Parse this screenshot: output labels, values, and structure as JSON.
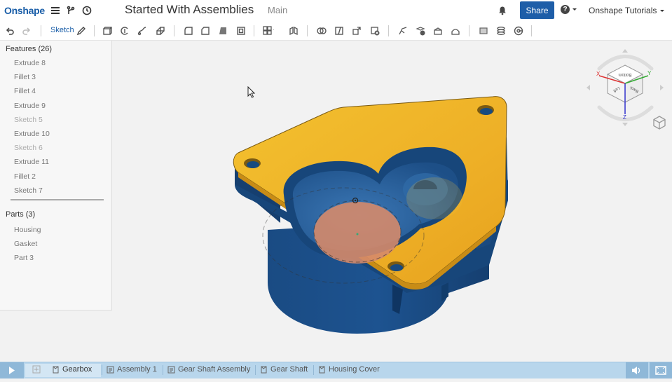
{
  "header": {
    "logo": "Onshape",
    "doc_title": "Started With Assemblies",
    "branch": "Main",
    "share_label": "Share",
    "help_label": "?",
    "user_label": "Onshape Tutorials",
    "icons": [
      "menu-icon",
      "branch-icon",
      "history-icon",
      "bell-icon",
      "help-icon",
      "chevron-down-icon"
    ]
  },
  "toolbar": {
    "sketch_label": "Sketch",
    "icons": [
      "undo-icon",
      "redo-icon",
      "pencil-icon",
      "extrude-icon",
      "revolve-icon",
      "sweep-icon",
      "loft-icon",
      "fillet-icon",
      "chamfer-icon",
      "draft-icon",
      "shell-icon",
      "pattern-icon",
      "mirror-icon",
      "boolean-icon",
      "split-icon",
      "transform-icon",
      "delete-part-icon",
      "modify-fillet-icon",
      "move-face-icon",
      "replace-face-icon",
      "offset-surface-icon",
      "plane-icon",
      "helix-icon",
      "mate-connector-icon"
    ]
  },
  "features": {
    "header": "Features (26)",
    "items": [
      {
        "label": "Extrude 8",
        "dim": false
      },
      {
        "label": "Fillet 3",
        "dim": false
      },
      {
        "label": "Fillet 4",
        "dim": false
      },
      {
        "label": "Extrude 9",
        "dim": false
      },
      {
        "label": "Sketch 5",
        "dim": true
      },
      {
        "label": "Extrude 10",
        "dim": false
      },
      {
        "label": "Sketch 6",
        "dim": true
      },
      {
        "label": "Extrude 11",
        "dim": false
      },
      {
        "label": "Fillet 2",
        "dim": false
      },
      {
        "label": "Sketch 7",
        "dim": false
      }
    ]
  },
  "parts": {
    "header": "Parts (3)",
    "items": [
      "Housing",
      "Gasket",
      "Part 3"
    ]
  },
  "viewcube": {
    "faces": [
      "Bottom",
      "Left",
      "Back"
    ],
    "axes": [
      "X",
      "Y",
      "Z"
    ]
  },
  "tabs": {
    "items": [
      {
        "label": "Gearbox",
        "active": true,
        "icon": "partstudio-icon"
      },
      {
        "label": "Assembly 1",
        "active": false,
        "icon": "assembly-icon"
      },
      {
        "label": "Gear Shaft Assembly",
        "active": false,
        "icon": "assembly-icon"
      },
      {
        "label": "Gear Shaft",
        "active": false,
        "icon": "partstudio-icon"
      },
      {
        "label": "Housing Cover",
        "active": false,
        "icon": "partstudio-icon"
      }
    ],
    "left_icons": [
      "play-icon",
      "add-tab-icon"
    ],
    "right_icons": [
      "sound-icon",
      "fullscreen-icon"
    ]
  },
  "colors": {
    "brand": "#1a5ea8",
    "part_face": "#f0b52a",
    "part_body": "#1c4f86",
    "tabbar": "#b8d6ec"
  }
}
